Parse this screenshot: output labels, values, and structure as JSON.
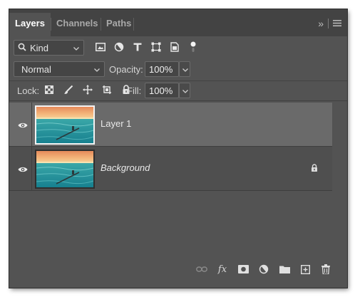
{
  "tabs": [
    {
      "label": "Layers",
      "active": true
    },
    {
      "label": "Channels",
      "active": false
    },
    {
      "label": "Paths",
      "active": false
    }
  ],
  "panel_menu": {
    "collapse_glyph": "»",
    "menu_icon": "hamburger-icon"
  },
  "filter": {
    "kind_label": "Kind",
    "icons": [
      "image-filter-icon",
      "adjustment-filter-icon",
      "type-filter-icon",
      "shape-filter-icon",
      "smart-object-filter-icon",
      "filter-toggle-icon"
    ]
  },
  "blend": {
    "mode": "Normal",
    "opacity_label": "Opacity:",
    "opacity_value": "100%"
  },
  "lock": {
    "label": "Lock:",
    "icons": [
      "lock-transparent-pixels-icon",
      "lock-image-pixels-icon",
      "lock-position-icon",
      "prevent-autonest-icon",
      "lock-all-icon"
    ],
    "fill_label": "Fill:",
    "fill_value": "100%"
  },
  "layers": [
    {
      "name": "Layer 1",
      "selected": true,
      "visible": true,
      "locked": false,
      "italic": false
    },
    {
      "name": "Background",
      "selected": false,
      "visible": true,
      "locked": true,
      "italic": true
    }
  ],
  "bottom_bar": {
    "fx_label": "fx",
    "icons": [
      "link-layers-icon",
      "layer-style-icon",
      "add-mask-icon",
      "adjustment-layer-icon",
      "new-group-icon",
      "new-layer-icon",
      "delete-layer-icon"
    ]
  },
  "colors": {
    "panel": "#535353",
    "tabbar": "#434343",
    "selected_row": "#6a6a6a",
    "sky_top": "#f0a86a",
    "sea": "#2aa3b2"
  }
}
